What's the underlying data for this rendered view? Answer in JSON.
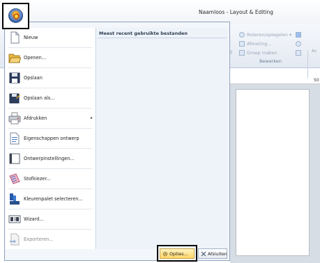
{
  "window": {
    "title": "Naamloos - Layout & Editing"
  },
  "ribbon": {
    "items": [
      "Roteren/spiegelen",
      "Afmeting...",
      "Groep maken"
    ],
    "group_label": "Bewerken",
    "partial_left": "g",
    "partial_right": "Ac"
  },
  "ruler": {
    "marker": "50"
  },
  "app_menu": {
    "recent_header": "Meest recent gebruikte bestanden",
    "items": [
      {
        "label": "Nieuw",
        "icon": "new-document-icon",
        "enabled": true
      },
      {
        "label": "Openen...",
        "icon": "open-folder-icon",
        "enabled": true
      },
      {
        "label": "Opslaan",
        "icon": "save-icon",
        "enabled": true
      },
      {
        "label": "Opslaan als...",
        "icon": "save-as-icon",
        "enabled": true
      },
      {
        "label": "Afdrukken",
        "icon": "print-icon",
        "enabled": true,
        "submenu": true
      },
      {
        "label": "Eigenschappen ontwerp",
        "icon": "design-properties-icon",
        "enabled": true
      },
      {
        "label": "Ontwerpinstellingen...",
        "icon": "design-settings-icon",
        "enabled": true
      },
      {
        "label": "Stofkiezer...",
        "icon": "fabric-selector-icon",
        "enabled": true
      },
      {
        "label": "Kleurenpalet selecteren...",
        "icon": "color-palette-icon",
        "enabled": true
      },
      {
        "label": "Wizard...",
        "icon": "wizard-icon",
        "enabled": true
      },
      {
        "label": "Exporteren...",
        "icon": "export-icon",
        "enabled": false
      }
    ],
    "options_label": "Opties...",
    "exit_label": "Afsluiten"
  },
  "colors": {
    "accent": "#ffd667",
    "menu_bg": "#f3f6fa",
    "border": "#8fa3bf"
  }
}
